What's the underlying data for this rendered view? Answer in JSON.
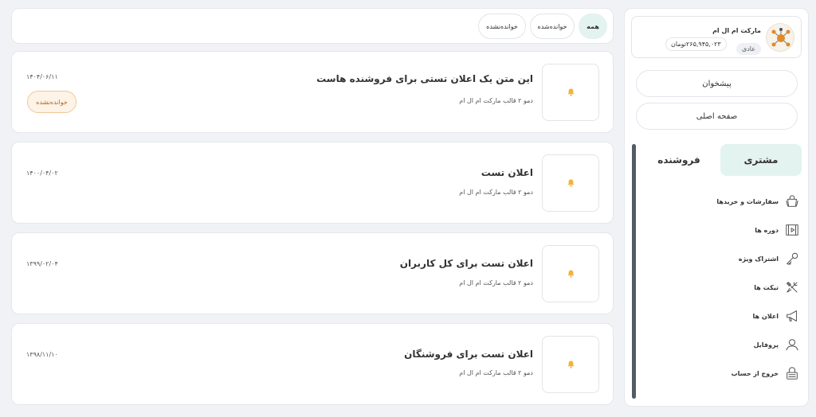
{
  "sidebar": {
    "store_name": "مارکت ام ال ام",
    "user_level": "عادی",
    "balance": "۲۶۵,۹۴۵,۰۲۳تومان",
    "dashboard_label": "پیشخوان",
    "home_label": "صفحه اصلی",
    "tabs": {
      "customer": "مشتری",
      "seller": "فروشنده"
    },
    "menu": [
      {
        "label": "سفارشات و خریدها",
        "icon": "shopping-bag-icon"
      },
      {
        "label": "دوره ها",
        "icon": "video-course-icon"
      },
      {
        "label": "اشتراک ویژه",
        "icon": "key-icon"
      },
      {
        "label": "تیکت ها",
        "icon": "tools-icon"
      },
      {
        "label": "اعلان ها",
        "icon": "megaphone-icon"
      },
      {
        "label": "پروفایل",
        "icon": "user-icon"
      },
      {
        "label": "خروج از حساب",
        "icon": "logout-icon"
      }
    ]
  },
  "filters": {
    "all": "همه",
    "read": "خوانده‌شده",
    "unread": "خوانده‌نشده"
  },
  "announcements": [
    {
      "title": "این متن یک اعلان تستی برای فروشنده هاست",
      "subtitle": "دمو ۲ قالب مارکت ام ال ام",
      "date": "۱۴۰۴/۰۶/۱۱",
      "status": "خوانده‌نشده"
    },
    {
      "title": "اعلان تست",
      "subtitle": "دمو ۲ قالب مارکت ام ال ام",
      "date": "۱۴۰۰/۰۴/۰۲",
      "status": ""
    },
    {
      "title": "اعلان تست برای کل کاربران",
      "subtitle": "دمو ۲ قالب مارکت ام ال ام",
      "date": "۱۳۹۹/۰۲/۰۴",
      "status": ""
    },
    {
      "title": "اعلان تست برای فروشنگان",
      "subtitle": "دمو ۲ قالب مارکت ام ال ام",
      "date": "۱۳۹۸/۱۱/۱۰",
      "status": ""
    }
  ],
  "colors": {
    "accent_light": "#e3f3f0",
    "bell": "#f2b33d",
    "badge_text": "#b5661c",
    "badge_bg": "#fdf3e6"
  }
}
